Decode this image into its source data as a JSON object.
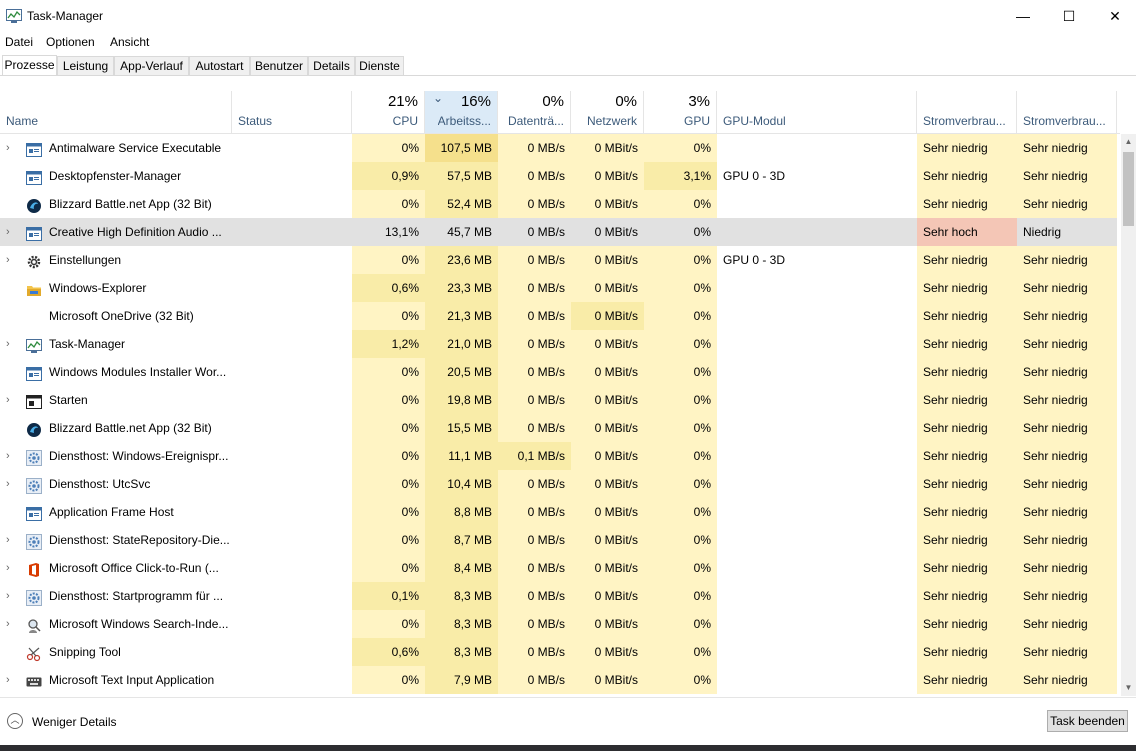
{
  "window": {
    "title": "Task-Manager",
    "minimize_glyph": "—",
    "maximize_glyph": "☐",
    "close_glyph": "✕"
  },
  "menu": [
    "Datei",
    "Optionen",
    "Ansicht"
  ],
  "tabs": [
    "Prozesse",
    "Leistung",
    "App-Verlauf",
    "Autostart",
    "Benutzer",
    "Details",
    "Dienste"
  ],
  "active_tab": "Prozesse",
  "columns": {
    "name": "Name",
    "status": "Status",
    "cpu": {
      "pct": "21%",
      "label": "CPU"
    },
    "mem": {
      "pct": "16%",
      "label": "Arbeitss..."
    },
    "disk": {
      "pct": "0%",
      "label": "Datenträ..."
    },
    "net": {
      "pct": "0%",
      "label": "Netzwerk"
    },
    "gpu": {
      "pct": "3%",
      "label": "GPU"
    },
    "gpumod": "GPU-Modul",
    "power": "Stromverbrau...",
    "power_trend": "Stromverbrau...",
    "sort_glyph": "⌄"
  },
  "colors": {
    "heat_low": "#fff4c4",
    "heat_mid": "#f9eca8",
    "heat_high": "#f5e08c",
    "power_high": "#f4c6b6",
    "selected": "#e1e1e1"
  },
  "processes": [
    {
      "name": "Antimalware Service Executable",
      "expand": true,
      "icon": "app-window-icon",
      "cpu": "0%",
      "mem": "107,5 MB",
      "disk": "0 MB/s",
      "net": "0 MBit/s",
      "gpu": "0%",
      "gpumod": "",
      "power": "Sehr niedrig",
      "trend": "Sehr niedrig",
      "heat": {
        "cpu": "low",
        "mem": "high",
        "disk": "low",
        "net": "low",
        "gpu": "low"
      }
    },
    {
      "name": "Desktopfenster-Manager",
      "expand": false,
      "icon": "app-window-icon",
      "cpu": "0,9%",
      "mem": "57,5 MB",
      "disk": "0 MB/s",
      "net": "0 MBit/s",
      "gpu": "3,1%",
      "gpumod": "GPU 0 - 3D",
      "power": "Sehr niedrig",
      "trend": "Sehr niedrig",
      "heat": {
        "cpu": "mid",
        "mem": "mid",
        "disk": "low",
        "net": "low",
        "gpu": "mid"
      }
    },
    {
      "name": "Blizzard Battle.net App (32 Bit)",
      "expand": false,
      "icon": "battlenet-icon",
      "cpu": "0%",
      "mem": "52,4 MB",
      "disk": "0 MB/s",
      "net": "0 MBit/s",
      "gpu": "0%",
      "gpumod": "",
      "power": "Sehr niedrig",
      "trend": "Sehr niedrig",
      "heat": {
        "cpu": "low",
        "mem": "mid",
        "disk": "low",
        "net": "low",
        "gpu": "low"
      }
    },
    {
      "name": "Creative High Definition Audio ...",
      "expand": true,
      "icon": "app-window-icon",
      "cpu": "13,1%",
      "mem": "45,7 MB",
      "disk": "0 MB/s",
      "net": "0 MBit/s",
      "gpu": "0%",
      "gpumod": "",
      "power": "Sehr hoch",
      "trend": "Niedrig",
      "selected": true,
      "heat": {
        "cpu": "mid",
        "mem": "mid",
        "disk": "low",
        "net": "low",
        "gpu": "low"
      }
    },
    {
      "name": "Einstellungen",
      "expand": true,
      "icon": "gear-icon",
      "cpu": "0%",
      "mem": "23,6 MB",
      "disk": "0 MB/s",
      "net": "0 MBit/s",
      "gpu": "0%",
      "gpumod": "GPU 0 - 3D",
      "power": "Sehr niedrig",
      "trend": "Sehr niedrig",
      "heat": {
        "cpu": "low",
        "mem": "mid",
        "disk": "low",
        "net": "low",
        "gpu": "low"
      }
    },
    {
      "name": "Windows-Explorer",
      "expand": false,
      "icon": "folder-icon",
      "cpu": "0,6%",
      "mem": "23,3 MB",
      "disk": "0 MB/s",
      "net": "0 MBit/s",
      "gpu": "0%",
      "gpumod": "",
      "power": "Sehr niedrig",
      "trend": "Sehr niedrig",
      "heat": {
        "cpu": "mid",
        "mem": "mid",
        "disk": "low",
        "net": "low",
        "gpu": "low"
      }
    },
    {
      "name": "Microsoft OneDrive (32 Bit)",
      "expand": false,
      "icon": "",
      "cpu": "0%",
      "mem": "21,3 MB",
      "disk": "0 MB/s",
      "net": "0 MBit/s",
      "gpu": "0%",
      "gpumod": "",
      "power": "Sehr niedrig",
      "trend": "Sehr niedrig",
      "heat": {
        "cpu": "low",
        "mem": "mid",
        "disk": "low",
        "net": "mid",
        "gpu": "low"
      }
    },
    {
      "name": "Task-Manager",
      "expand": true,
      "icon": "task-manager-icon",
      "cpu": "1,2%",
      "mem": "21,0 MB",
      "disk": "0 MB/s",
      "net": "0 MBit/s",
      "gpu": "0%",
      "gpumod": "",
      "power": "Sehr niedrig",
      "trend": "Sehr niedrig",
      "heat": {
        "cpu": "mid",
        "mem": "mid",
        "disk": "low",
        "net": "low",
        "gpu": "low"
      }
    },
    {
      "name": "Windows Modules Installer Wor...",
      "expand": false,
      "icon": "app-window-icon",
      "cpu": "0%",
      "mem": "20,5 MB",
      "disk": "0 MB/s",
      "net": "0 MBit/s",
      "gpu": "0%",
      "gpumod": "",
      "power": "Sehr niedrig",
      "trend": "Sehr niedrig",
      "heat": {
        "cpu": "low",
        "mem": "mid",
        "disk": "low",
        "net": "low",
        "gpu": "low"
      }
    },
    {
      "name": "Starten",
      "expand": true,
      "icon": "start-icon",
      "cpu": "0%",
      "mem": "19,8 MB",
      "disk": "0 MB/s",
      "net": "0 MBit/s",
      "gpu": "0%",
      "gpumod": "",
      "power": "Sehr niedrig",
      "trend": "Sehr niedrig",
      "heat": {
        "cpu": "low",
        "mem": "mid",
        "disk": "low",
        "net": "low",
        "gpu": "low"
      }
    },
    {
      "name": "Blizzard Battle.net App (32 Bit)",
      "expand": false,
      "icon": "battlenet-icon",
      "cpu": "0%",
      "mem": "15,5 MB",
      "disk": "0 MB/s",
      "net": "0 MBit/s",
      "gpu": "0%",
      "gpumod": "",
      "power": "Sehr niedrig",
      "trend": "Sehr niedrig",
      "heat": {
        "cpu": "low",
        "mem": "mid",
        "disk": "low",
        "net": "low",
        "gpu": "low"
      }
    },
    {
      "name": "Diensthost: Windows-Ereignispr...",
      "expand": true,
      "icon": "service-gear-icon",
      "cpu": "0%",
      "mem": "11,1 MB",
      "disk": "0,1 MB/s",
      "net": "0 MBit/s",
      "gpu": "0%",
      "gpumod": "",
      "power": "Sehr niedrig",
      "trend": "Sehr niedrig",
      "heat": {
        "cpu": "low",
        "mem": "mid",
        "disk": "mid",
        "net": "low",
        "gpu": "low"
      }
    },
    {
      "name": "Diensthost: UtcSvc",
      "expand": true,
      "icon": "service-gear-icon",
      "cpu": "0%",
      "mem": "10,4 MB",
      "disk": "0 MB/s",
      "net": "0 MBit/s",
      "gpu": "0%",
      "gpumod": "",
      "power": "Sehr niedrig",
      "trend": "Sehr niedrig",
      "heat": {
        "cpu": "low",
        "mem": "mid",
        "disk": "low",
        "net": "low",
        "gpu": "low"
      }
    },
    {
      "name": "Application Frame Host",
      "expand": false,
      "icon": "app-window-icon",
      "cpu": "0%",
      "mem": "8,8 MB",
      "disk": "0 MB/s",
      "net": "0 MBit/s",
      "gpu": "0%",
      "gpumod": "",
      "power": "Sehr niedrig",
      "trend": "Sehr niedrig",
      "heat": {
        "cpu": "low",
        "mem": "mid",
        "disk": "low",
        "net": "low",
        "gpu": "low"
      }
    },
    {
      "name": "Diensthost: StateRepository-Die...",
      "expand": true,
      "icon": "service-gear-icon",
      "cpu": "0%",
      "mem": "8,7 MB",
      "disk": "0 MB/s",
      "net": "0 MBit/s",
      "gpu": "0%",
      "gpumod": "",
      "power": "Sehr niedrig",
      "trend": "Sehr niedrig",
      "heat": {
        "cpu": "low",
        "mem": "mid",
        "disk": "low",
        "net": "low",
        "gpu": "low"
      }
    },
    {
      "name": "Microsoft Office Click-to-Run (...",
      "expand": true,
      "icon": "office-icon",
      "cpu": "0%",
      "mem": "8,4 MB",
      "disk": "0 MB/s",
      "net": "0 MBit/s",
      "gpu": "0%",
      "gpumod": "",
      "power": "Sehr niedrig",
      "trend": "Sehr niedrig",
      "heat": {
        "cpu": "low",
        "mem": "mid",
        "disk": "low",
        "net": "low",
        "gpu": "low"
      }
    },
    {
      "name": "Diensthost: Startprogramm für ...",
      "expand": true,
      "icon": "service-gear-icon",
      "cpu": "0,1%",
      "mem": "8,3 MB",
      "disk": "0 MB/s",
      "net": "0 MBit/s",
      "gpu": "0%",
      "gpumod": "",
      "power": "Sehr niedrig",
      "trend": "Sehr niedrig",
      "heat": {
        "cpu": "mid",
        "mem": "mid",
        "disk": "low",
        "net": "low",
        "gpu": "low"
      }
    },
    {
      "name": "Microsoft Windows Search-Inde...",
      "expand": true,
      "icon": "search-indexer-icon",
      "cpu": "0%",
      "mem": "8,3 MB",
      "disk": "0 MB/s",
      "net": "0 MBit/s",
      "gpu": "0%",
      "gpumod": "",
      "power": "Sehr niedrig",
      "trend": "Sehr niedrig",
      "heat": {
        "cpu": "low",
        "mem": "mid",
        "disk": "low",
        "net": "low",
        "gpu": "low"
      }
    },
    {
      "name": "Snipping Tool",
      "expand": false,
      "icon": "scissors-icon",
      "cpu": "0,6%",
      "mem": "8,3 MB",
      "disk": "0 MB/s",
      "net": "0 MBit/s",
      "gpu": "0%",
      "gpumod": "",
      "power": "Sehr niedrig",
      "trend": "Sehr niedrig",
      "heat": {
        "cpu": "mid",
        "mem": "mid",
        "disk": "low",
        "net": "low",
        "gpu": "low"
      }
    },
    {
      "name": "Microsoft Text Input Application",
      "expand": true,
      "icon": "keyboard-icon",
      "cpu": "0%",
      "mem": "7,9 MB",
      "disk": "0 MB/s",
      "net": "0 MBit/s",
      "gpu": "0%",
      "gpumod": "",
      "power": "Sehr niedrig",
      "trend": "Sehr niedrig",
      "heat": {
        "cpu": "low",
        "mem": "mid",
        "disk": "low",
        "net": "low",
        "gpu": "low"
      }
    }
  ],
  "footer": {
    "fewer_details": "Weniger Details",
    "end_task": "Task beenden"
  }
}
